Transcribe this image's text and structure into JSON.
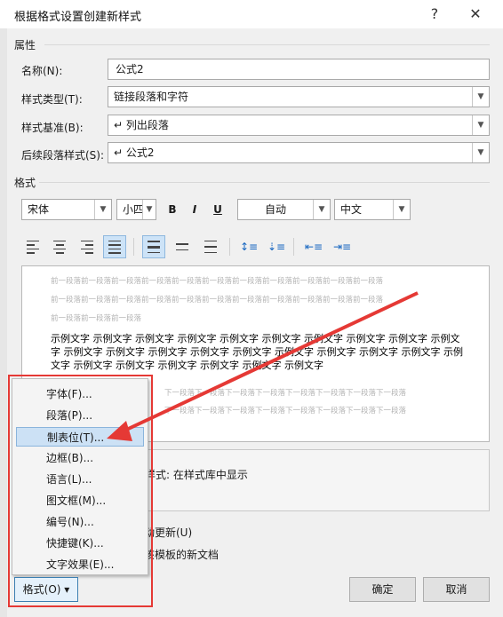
{
  "dialog": {
    "title": "根据格式设置创建新样式",
    "help_label": "?",
    "close_label": "✕"
  },
  "properties": {
    "section_label": "属性",
    "name_label": "名称(N):",
    "name_value": "公式2",
    "style_type_label": "样式类型(T):",
    "style_type_value": "链接段落和字符",
    "based_on_label": "样式基准(B):",
    "based_on_value": "↵ 列出段落",
    "following_label": "后续段落样式(S):",
    "following_value": "↵ 公式2"
  },
  "format": {
    "section_label": "格式",
    "font_value": "宋体",
    "size_value": "小四",
    "bold_label": "B",
    "italic_label": "I",
    "underline_label": "U",
    "color_value": "自动",
    "lang_value": "中文"
  },
  "preview": {
    "prev_para_lines": [
      "前一段落前一段落前一段落前一段落前一段落前一段落前一段落前一段落前一段落前一段落前一段落",
      "前一段落前一段落前一段落前一段落前一段落前一段落前一段落前一段落前一段落前一段落前一段落",
      "前一段落前一段落前一段落"
    ],
    "sample_text": "示例文字 示例文字 示例文字 示例文字 示例文字 示例文字 示例文字 示例文字 示例文字 示例文字 示例文字 示例文字 示例文字 示例文字 示例文字 示例文字 示例文字 示例文字 示例文字 示例文字 示例文字 示例文字 示例文字 示例文字 示例文字 示例文字",
    "next_para_lines": [
      "下一段落下一段落下一段落下一段落下一段落下一段落下一段落下一段落",
      "下一段落下一段落下一段落下一段落下一段落下一段落下一段落下一段落"
    ]
  },
  "description": {
    "text": "样式: 在样式库中显示"
  },
  "options": {
    "auto_update_label": "动更新(U)",
    "template_label": "该模板的新文档"
  },
  "menu": {
    "items": [
      "字体(F)...",
      "段落(P)...",
      "制表位(T)...",
      "边框(B)...",
      "语言(L)...",
      "图文框(M)...",
      "编号(N)...",
      "快捷键(K)...",
      "文字效果(E)..."
    ]
  },
  "buttons": {
    "format_label": "格式(O) ▾",
    "ok_label": "确定",
    "cancel_label": "取消"
  },
  "colors": {
    "annotation": "#e53935",
    "highlight": "#cce1f5"
  }
}
